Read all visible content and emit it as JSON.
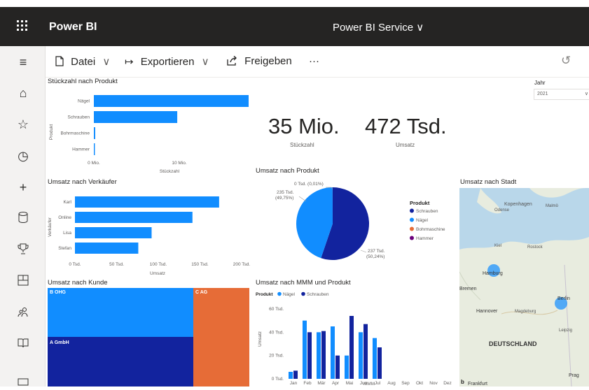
{
  "topbar": {
    "app_name": "Power BI",
    "service_label": "Power BI Service ∨",
    "waffle_icon": "waffle-icon"
  },
  "nav_icons": [
    "hamburger-icon",
    "home-icon",
    "star-icon",
    "clock-icon",
    "plus-icon",
    "database-icon",
    "trophy-icon",
    "apps-icon",
    "people-icon",
    "book-icon",
    "monitor-icon"
  ],
  "commands": {
    "file": "Datei",
    "export": "Exportieren",
    "share": "Freigeben",
    "more": "···"
  },
  "slicer": {
    "label": "Jahr",
    "value": "2021"
  },
  "cards": [
    {
      "value": "35 Mio.",
      "label": "Stückzahl"
    },
    {
      "value": "472 Tsd.",
      "label": "Umsatz"
    }
  ],
  "titles": {
    "qty_by_product": "Stückzahl nach Produkt",
    "rev_by_seller": "Umsatz nach Verkäufer",
    "rev_by_product": "Umsatz nach Produkt",
    "rev_by_city": "Umsatz nach Stadt",
    "rev_by_customer": "Umsatz nach Kunde",
    "rev_by_month_product": "Umsatz nach MMM und Produkt"
  },
  "chart_data": [
    {
      "type": "bar",
      "orientation": "horizontal",
      "title": "Stückzahl nach Produkt",
      "ylabel": "Produkt",
      "xlabel": "Stückzahl",
      "categories": [
        "Nägel",
        "Schrauben",
        "Bohrmaschine",
        "Hammer"
      ],
      "values": [
        24500000,
        12200000,
        200000,
        150000
      ],
      "xticks": [
        "0 Mio.",
        "10 Mio.",
        "20 Mio."
      ],
      "xlim": [
        0,
        25000000
      ]
    },
    {
      "type": "bar",
      "orientation": "horizontal",
      "title": "Umsatz nach Verkäufer",
      "ylabel": "Verkäufer",
      "xlabel": "Umsatz",
      "categories": [
        "Karl",
        "Online",
        "Lisa",
        "Stefan"
      ],
      "values": [
        173000,
        141000,
        92000,
        76000
      ],
      "xticks": [
        "0 Tsd.",
        "50 Tsd.",
        "100 Tsd.",
        "150 Tsd.",
        "200 Tsd."
      ],
      "xlim": [
        0,
        200000
      ]
    },
    {
      "type": "pie",
      "title": "Umsatz nach Produkt",
      "legend_title": "Produkt",
      "labels": [
        "Schrauben",
        "Nägel",
        "Bohrmaschine",
        "Hammer"
      ],
      "values": [
        50.24,
        40.75,
        0.01,
        0.01
      ],
      "colors": [
        "#12239e",
        "#118dff",
        "#e66c37",
        "#6b007b"
      ],
      "data_labels": [
        "237 Tsd. (50,24%)",
        "235 Tsd. (49,75%)",
        "0 Tsd. (0,01%)"
      ]
    },
    {
      "type": "treemap",
      "title": "Umsatz nach Kunde",
      "labels": [
        "A GmbH",
        "B OHG",
        "C AG"
      ],
      "colors": [
        "#12239e",
        "#118dff",
        "#e66c37"
      ]
    },
    {
      "type": "bar",
      "title": "Umsatz nach MMM und Produkt",
      "legend_title": "Produkt",
      "ylabel": "Umsatz",
      "xlabel": "MMM",
      "categories": [
        "Jan",
        "Feb",
        "Mär",
        "Apr",
        "Mai",
        "Jun",
        "Jul",
        "Aug",
        "Sep",
        "Okt",
        "Nov",
        "Dez"
      ],
      "series": [
        {
          "name": "Nägel",
          "color": "#118dff",
          "values": [
            6,
            50,
            40,
            45,
            20,
            40,
            35,
            0,
            0,
            0,
            0,
            0
          ]
        },
        {
          "name": "Schrauben",
          "color": "#12239e",
          "values": [
            7,
            40,
            41,
            20,
            54,
            47,
            27,
            0,
            0,
            0,
            0,
            0
          ]
        }
      ],
      "yticks": [
        "0 Tsd.",
        "20 Tsd.",
        "40 Tsd.",
        "60 Tsd."
      ],
      "ylim": [
        0,
        60
      ]
    }
  ],
  "map": {
    "labels": [
      "Hamburg",
      "Berlin",
      "DEUTSCHLAND",
      "Hannover",
      "Bremen",
      "Magdeburg",
      "Rostock",
      "Kiel",
      "Kopenhagen",
      "Malmö",
      "Odense",
      "Frankfurt",
      "Prag",
      "Leipzig"
    ],
    "bubbles": [
      "Hamburg",
      "Berlin"
    ]
  }
}
